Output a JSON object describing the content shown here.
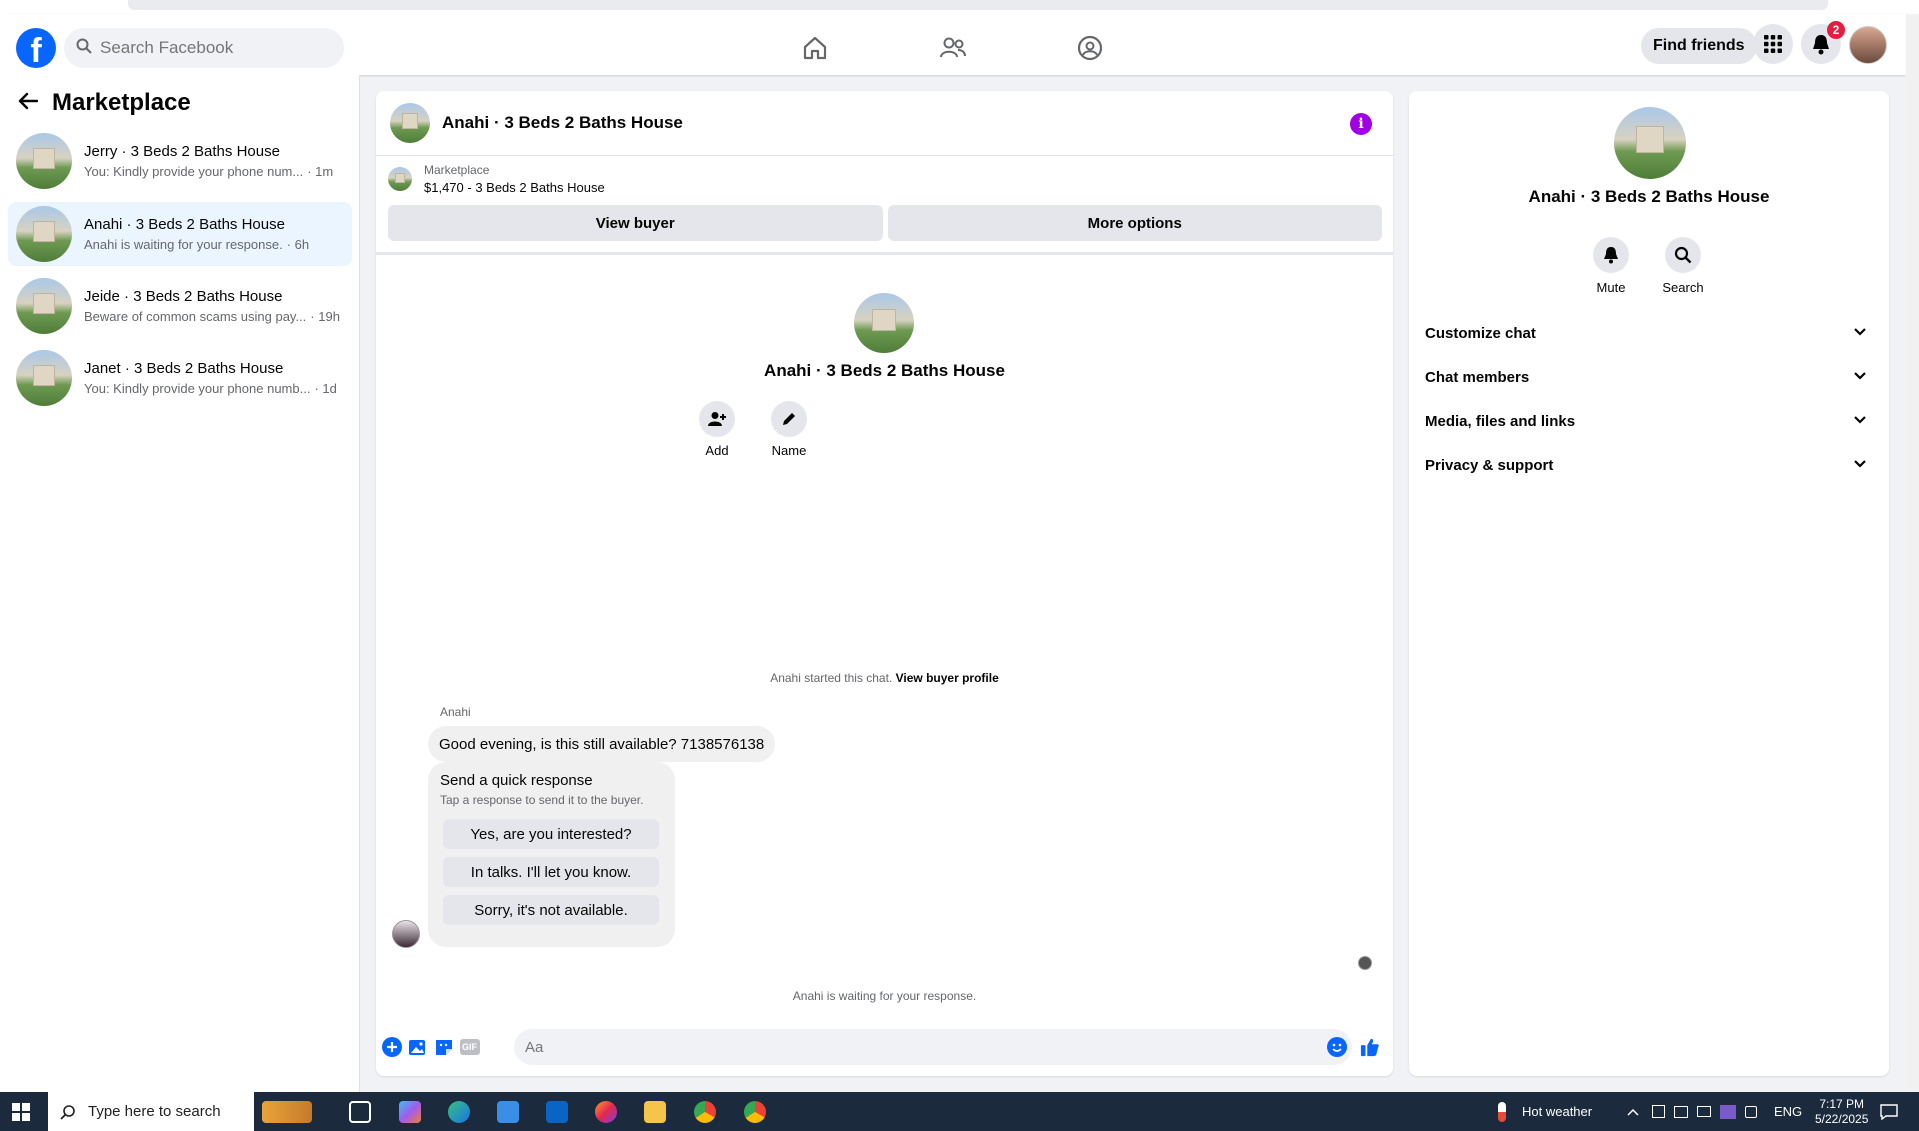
{
  "topnav": {
    "logo": "f",
    "search_placeholder": "Search Facebook",
    "find_friends": "Find friends",
    "notification_count": "2"
  },
  "sidebar": {
    "title": "Marketplace",
    "conversations": [
      {
        "name": "Jerry · 3 Beds 2 Baths House",
        "preview": "You: Kindly provide your phone num...",
        "time": "· 1m",
        "active": false
      },
      {
        "name": "Anahi · 3 Beds 2 Baths House",
        "preview": "Anahi is waiting for your response.",
        "time": "· 6h",
        "active": true
      },
      {
        "name": "Jeide · 3 Beds 2 Baths House",
        "preview": "Beware of common scams using pay...",
        "time": "· 19h",
        "active": false
      },
      {
        "name": "Janet · 3 Beds 2 Baths House",
        "preview": "You: Kindly provide your phone numb...",
        "time": "· 1d",
        "active": false
      }
    ]
  },
  "chat": {
    "title": "Anahi · 3 Beds 2 Baths House",
    "listing_label": "Marketplace",
    "listing_price": "$1,470 - 3 Beds 2 Baths House",
    "view_buyer": "View buyer",
    "more_options": "More options",
    "center_title": "Anahi · 3 Beds 2 Baths House",
    "add_label": "Add",
    "name_label": "Name",
    "started_text": "Anahi started this chat.",
    "view_buyer_profile": "View buyer profile",
    "sender": "Anahi",
    "message": "Good evening, is this still available? 7138576138",
    "quick_title": "Send a quick response",
    "quick_subtitle": "Tap a response to send it to the buyer.",
    "quick_options": [
      "Yes, are you interested?",
      "In talks. I'll let you know.",
      "Sorry, it's not available."
    ],
    "waiting": "Anahi is waiting for your response.",
    "composer_placeholder": "Aa",
    "gif_label": "GIF"
  },
  "details": {
    "title": "Anahi · 3 Beds 2 Baths House",
    "mute": "Mute",
    "search": "Search",
    "sections": [
      "Customize chat",
      "Chat members",
      "Media, files and links",
      "Privacy & support"
    ]
  },
  "taskbar": {
    "search_placeholder": "Type here to search",
    "weather": "Hot weather",
    "language": "ENG",
    "time": "7:17 PM",
    "date": "5/22/2025"
  },
  "colors": {
    "brand": "#0866ff",
    "active_conversation": "#ebf5ff",
    "info_button": "#a100e3",
    "badge": "#e41e3f"
  }
}
